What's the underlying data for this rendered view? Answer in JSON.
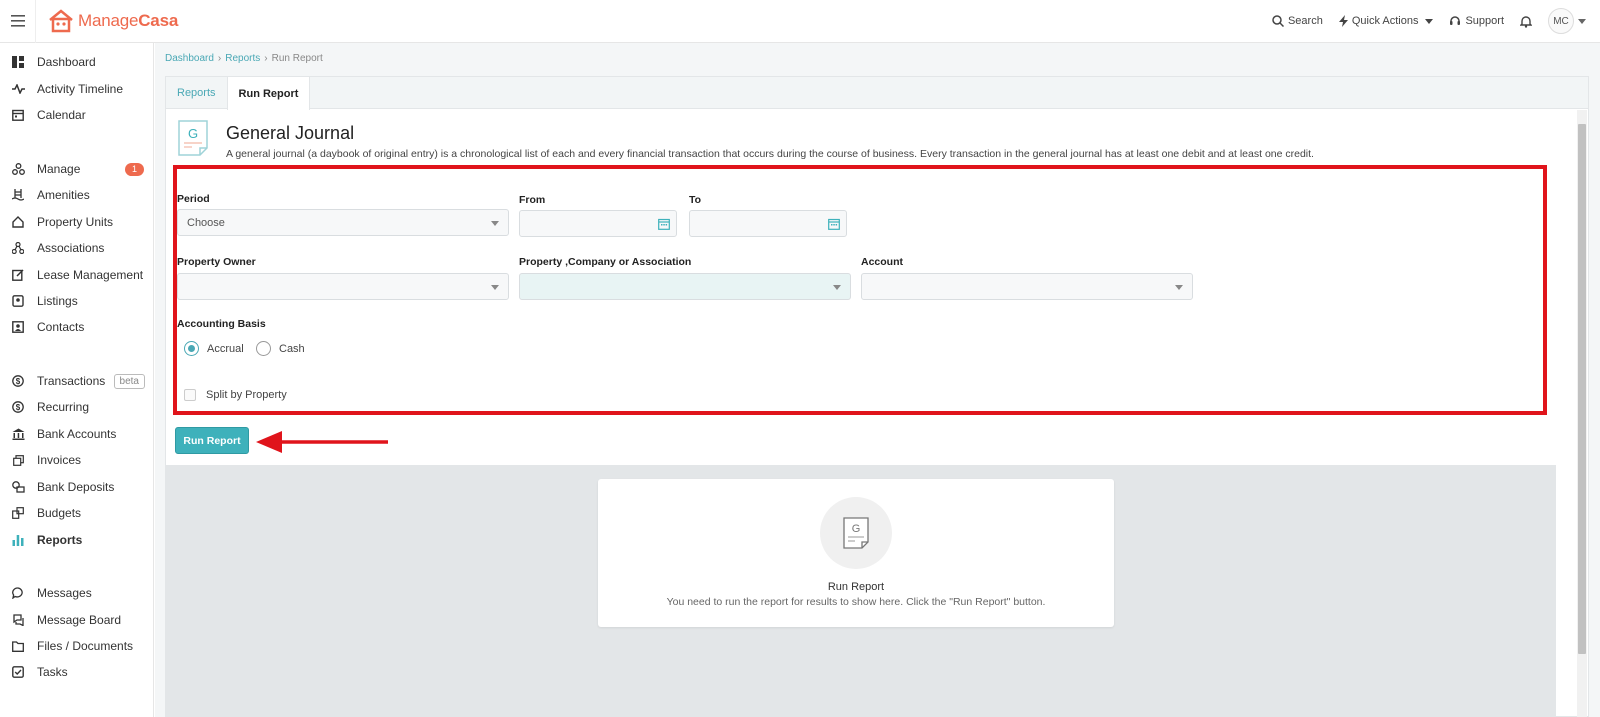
{
  "brand": {
    "name_part1": "Manage",
    "name_part2": "Casa",
    "color": "#ee6a4e"
  },
  "topbar": {
    "search": "Search",
    "quick_actions": "Quick Actions",
    "support": "Support",
    "avatar": "MC"
  },
  "sidebar": {
    "items": [
      {
        "label": "Dashboard",
        "icon": "dashboard-icon"
      },
      {
        "label": "Activity Timeline",
        "icon": "activity-icon"
      },
      {
        "label": "Calendar",
        "icon": "calendar-icon"
      },
      {
        "label": "Manage",
        "icon": "manage-icon",
        "badge": "1"
      },
      {
        "label": "Amenities",
        "icon": "amenities-icon"
      },
      {
        "label": "Property Units",
        "icon": "home-icon"
      },
      {
        "label": "Associations",
        "icon": "associations-icon"
      },
      {
        "label": "Lease Management",
        "icon": "lease-icon"
      },
      {
        "label": "Listings",
        "icon": "listings-icon"
      },
      {
        "label": "Contacts",
        "icon": "contacts-icon"
      },
      {
        "label": "Transactions",
        "icon": "dollar-icon",
        "tag": "beta"
      },
      {
        "label": "Recurring",
        "icon": "dollar-icon"
      },
      {
        "label": "Bank Accounts",
        "icon": "bank-icon"
      },
      {
        "label": "Invoices",
        "icon": "invoices-icon"
      },
      {
        "label": "Bank Deposits",
        "icon": "deposit-icon"
      },
      {
        "label": "Budgets",
        "icon": "budgets-icon"
      },
      {
        "label": "Reports",
        "icon": "reports-icon",
        "active": true
      },
      {
        "label": "Messages",
        "icon": "messages-icon"
      },
      {
        "label": "Message Board",
        "icon": "message-board-icon"
      },
      {
        "label": "Files / Documents",
        "icon": "folder-icon"
      },
      {
        "label": "Tasks",
        "icon": "tasks-icon"
      }
    ]
  },
  "breadcrumb": {
    "home": "Dashboard",
    "reports": "Reports",
    "current": "Run Report"
  },
  "tabs": {
    "reports": "Reports",
    "run_report": "Run Report"
  },
  "report": {
    "icon_letter": "G",
    "title": "General Journal",
    "description": "A general journal (a daybook of original entry) is a chronological list of each and every financial transaction that occurs during the course of business. Every transaction in the general journal has at least one debit and at least one credit."
  },
  "form": {
    "period_label": "Period",
    "period_value": "Choose",
    "from_label": "From",
    "to_label": "To",
    "owner_label": "Property Owner",
    "property_label": "Property ,Company or Association",
    "account_label": "Account",
    "basis_label": "Accounting Basis",
    "basis_accrual": "Accrual",
    "basis_cash": "Cash",
    "split_label": "Split by Property"
  },
  "run_button": "Run Report",
  "empty_state": {
    "title": "Run Report",
    "text": "You need to run the report for results to show here. Click the \"Run Report\" button."
  },
  "colors": {
    "accent": "#3eb1bb",
    "highlight": "#e0141b"
  }
}
